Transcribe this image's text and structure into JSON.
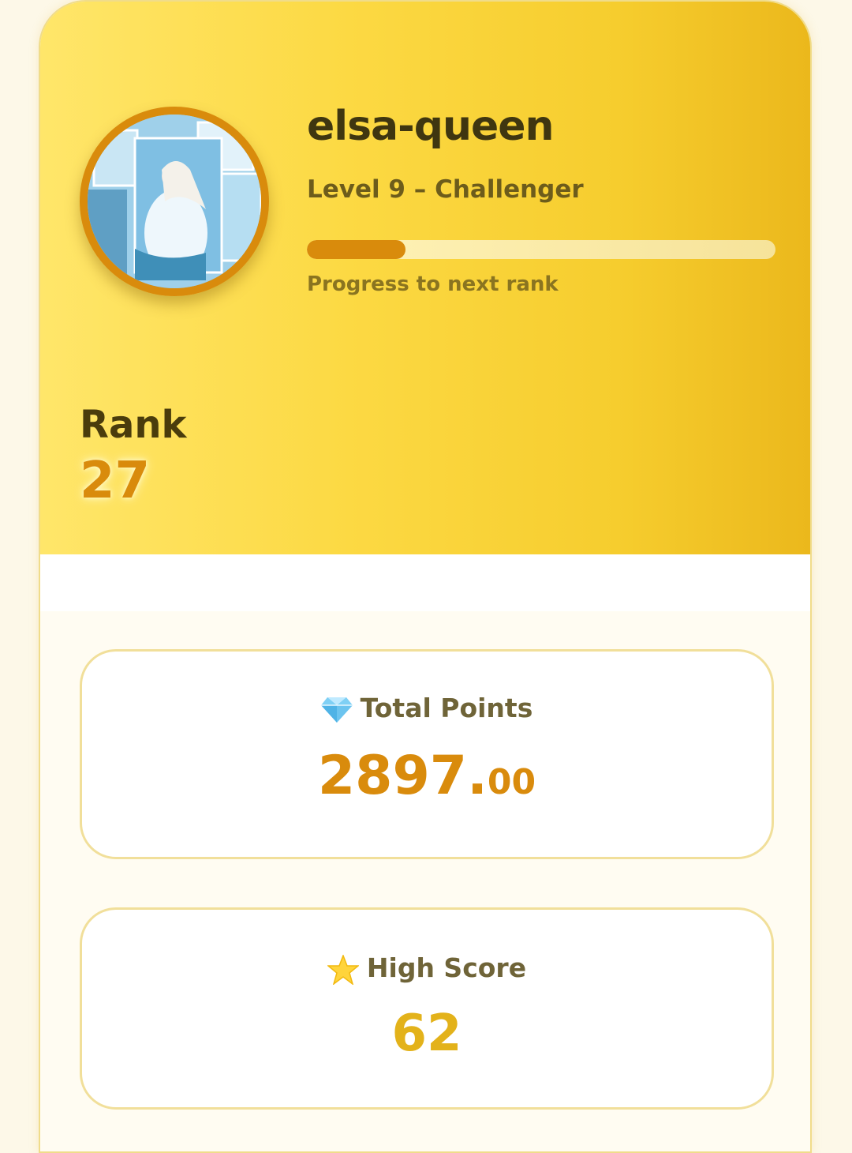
{
  "profile": {
    "username": "elsa-queen",
    "level_text": "Level 9 – Challenger",
    "progress": {
      "fraction": 0.21,
      "label": "Progress to next rank"
    },
    "avatar_icon": "avatar-image"
  },
  "rank": {
    "label": "Rank",
    "value": "27"
  },
  "stats": {
    "total_points": {
      "icon": "gem-icon",
      "label": "Total Points",
      "value_int": "2897.",
      "value_dec": "00"
    },
    "high_score": {
      "icon": "star-icon",
      "label": "High Score",
      "value": "62"
    }
  },
  "colors": {
    "accent": "#d98b0c",
    "hero_start": "#ffe66a",
    "hero_end": "#ebb81c",
    "high_score": "#e3b21a"
  }
}
